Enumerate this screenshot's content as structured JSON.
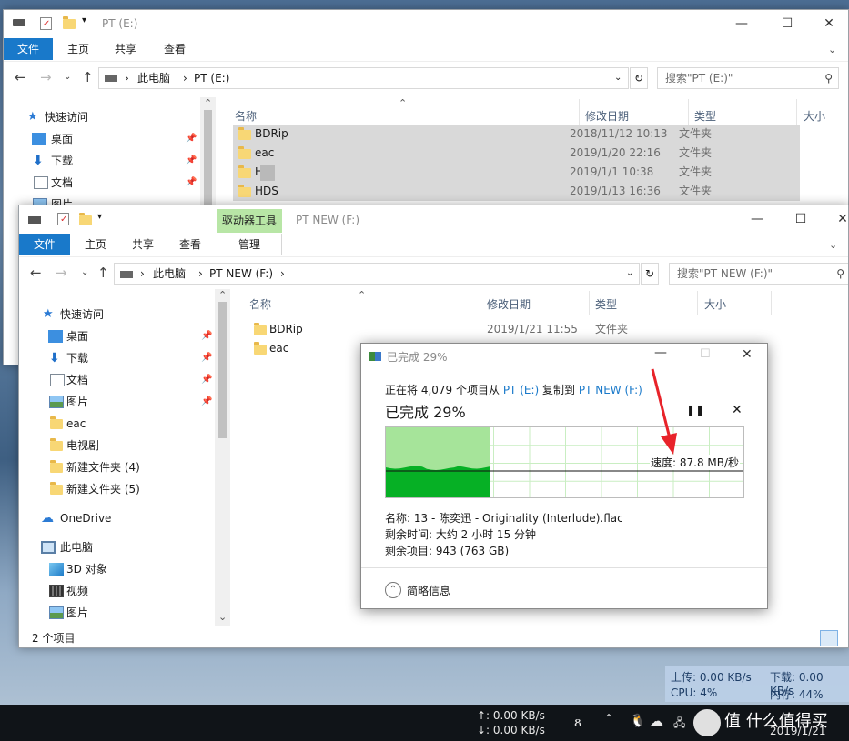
{
  "back_window": {
    "title": "PT (E:)",
    "tabs": [
      "文件",
      "主页",
      "共享",
      "查看"
    ],
    "address": [
      "此电脑",
      "PT (E:)"
    ],
    "search_placeholder": "搜索\"PT (E:)\"",
    "columns": [
      "名称",
      "修改日期",
      "类型",
      "大小"
    ],
    "nav_quick_access": "快速访问",
    "nav_items": [
      "桌面",
      "下载",
      "文档",
      "图片"
    ],
    "rows": [
      {
        "name": "BDRip",
        "date": "2018/11/12 10:13",
        "type": "文件夹"
      },
      {
        "name": "eac",
        "date": "2019/1/20 22:16",
        "type": "文件夹"
      },
      {
        "name": "H",
        "date": "2019/1/1 10:38",
        "type": "文件夹"
      },
      {
        "name": "HDS",
        "date": "2019/1/13 16:36",
        "type": "文件夹"
      }
    ]
  },
  "front_window": {
    "title": "PT NEW (F:)",
    "context_tab_header": "驱动器工具",
    "tabs": [
      "文件",
      "主页",
      "共享",
      "查看",
      "管理"
    ],
    "address": [
      "此电脑",
      "PT NEW (F:)"
    ],
    "search_placeholder": "搜索\"PT NEW (F:)\"",
    "columns": [
      "名称",
      "修改日期",
      "类型",
      "大小"
    ],
    "nav": {
      "quick_access": "快速访问",
      "quick_items": [
        "桌面",
        "下载",
        "文档",
        "图片"
      ],
      "folders": [
        "eac",
        "电视剧",
        "新建文件夹 (4)",
        "新建文件夹 (5)"
      ],
      "onedrive": "OneDrive",
      "this_pc": "此电脑",
      "pc_items": [
        "3D 对象",
        "视频",
        "图片"
      ]
    },
    "rows": [
      {
        "name": "BDRip",
        "date": "2019/1/21 11:55",
        "type": "文件夹"
      },
      {
        "name": "eac",
        "date": "",
        "type": ""
      }
    ],
    "status_count": "2 个项目"
  },
  "copy_dialog": {
    "title": "已完成 29%",
    "line_prefix": "正在将 4,079 个项目从",
    "source": "PT (E:)",
    "copy_to": "复制到",
    "target": "PT NEW (F:)",
    "heading": "已完成 29%",
    "progress_fraction": 0.29,
    "speed": "速度: 87.8 MB/秒",
    "name": "名称: 13 - 陈奕迅 - Originality (Interlude).flac",
    "time_left": "剩余时间: 大约 2 小时 15 分钟",
    "items_left": "剩余项目: 943 (763 GB)",
    "details_toggle": "简略信息",
    "pause_icon": "pause-icon",
    "cancel_icon": "close-icon",
    "colors": {
      "progress_fill": "#06b025",
      "progress_light": "#a6e49a",
      "link": "#1979ca"
    }
  },
  "net_monitor": {
    "upload": "上传: 0.00 KB/s",
    "download": "下载: 0.00 KB/s",
    "cpu": "CPU: 4%",
    "memory": "内存: 44%"
  },
  "taskbar": {
    "net_up": "↑: 0.00 KB/s",
    "net_down": "↓: 0.00 KB/s",
    "watermark": "值 什么值得买",
    "date": "2019/1/21"
  }
}
